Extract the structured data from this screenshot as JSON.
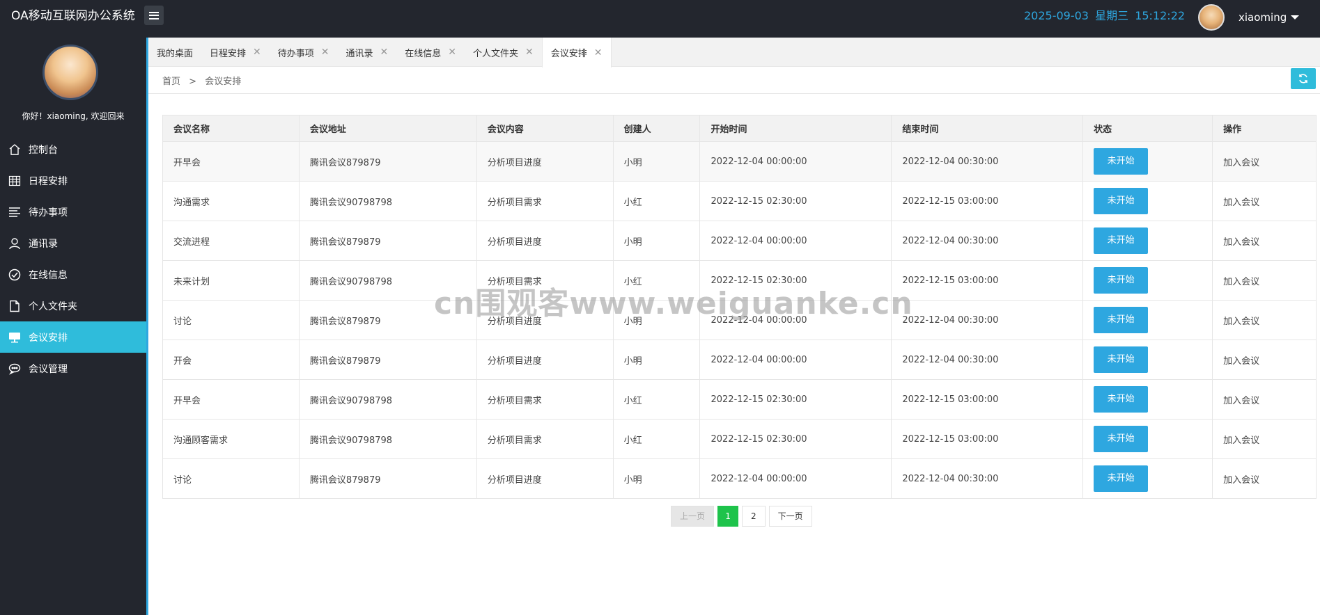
{
  "header": {
    "app_title": "OA移动互联网办公系统",
    "date": "2025-09-03",
    "weekday": "星期三",
    "time": "15:12:22",
    "username": "xiaoming"
  },
  "sidebar": {
    "welcome": "你好！xiaoming, 欢迎回来",
    "items": [
      {
        "label": "控制台",
        "icon": "home-icon"
      },
      {
        "label": "日程安排",
        "icon": "calendar-grid-icon"
      },
      {
        "label": "待办事项",
        "icon": "list-icon"
      },
      {
        "label": "通讯录",
        "icon": "user-icon"
      },
      {
        "label": "在线信息",
        "icon": "check-circle-icon"
      },
      {
        "label": "个人文件夹",
        "icon": "file-icon"
      },
      {
        "label": "会议安排",
        "icon": "presentation-icon",
        "active": true
      },
      {
        "label": "会议管理",
        "icon": "chat-icon"
      }
    ]
  },
  "tabs": [
    {
      "label": "我的桌面",
      "closable": false
    },
    {
      "label": "日程安排",
      "closable": true
    },
    {
      "label": "待办事项",
      "closable": true
    },
    {
      "label": "通讯录",
      "closable": true
    },
    {
      "label": "在线信息",
      "closable": true
    },
    {
      "label": "个人文件夹",
      "closable": true
    },
    {
      "label": "会议安排",
      "closable": true,
      "active": true
    }
  ],
  "breadcrumb": {
    "home": "首页",
    "separator": ">",
    "current": "会议安排"
  },
  "table": {
    "headers": [
      "会议名称",
      "会议地址",
      "会议内容",
      "创建人",
      "开始时间",
      "结束时间",
      "状态",
      "操作"
    ],
    "rows": [
      [
        "开早会",
        "腾讯会议879879",
        "分析项目进度",
        "小明",
        "2022-12-04 00:00:00",
        "2022-12-04 00:30:00",
        "未开始",
        "加入会议"
      ],
      [
        "沟通需求",
        "腾讯会议90798798",
        "分析项目需求",
        "小红",
        "2022-12-15 02:30:00",
        "2022-12-15 03:00:00",
        "未开始",
        "加入会议"
      ],
      [
        "交流进程",
        "腾讯会议879879",
        "分析项目进度",
        "小明",
        "2022-12-04 00:00:00",
        "2022-12-04 00:30:00",
        "未开始",
        "加入会议"
      ],
      [
        "未来计划",
        "腾讯会议90798798",
        "分析项目需求",
        "小红",
        "2022-12-15 02:30:00",
        "2022-12-15 03:00:00",
        "未开始",
        "加入会议"
      ],
      [
        "讨论",
        "腾讯会议879879",
        "分析项目进度",
        "小明",
        "2022-12-04 00:00:00",
        "2022-12-04 00:30:00",
        "未开始",
        "加入会议"
      ],
      [
        "开会",
        "腾讯会议879879",
        "分析项目进度",
        "小明",
        "2022-12-04 00:00:00",
        "2022-12-04 00:30:00",
        "未开始",
        "加入会议"
      ],
      [
        "开早会",
        "腾讯会议90798798",
        "分析项目需求",
        "小红",
        "2022-12-15 02:30:00",
        "2022-12-15 03:00:00",
        "未开始",
        "加入会议"
      ],
      [
        "沟通顾客需求",
        "腾讯会议90798798",
        "分析项目需求",
        "小红",
        "2022-12-15 02:30:00",
        "2022-12-15 03:00:00",
        "未开始",
        "加入会议"
      ],
      [
        "讨论",
        "腾讯会议879879",
        "分析项目进度",
        "小明",
        "2022-12-04 00:00:00",
        "2022-12-04 00:30:00",
        "未开始",
        "加入会议"
      ]
    ]
  },
  "pagination": {
    "prev": "上一页",
    "pages": [
      "1",
      "2"
    ],
    "current": "1",
    "next": "下一页"
  },
  "watermark": "cn围观客www.weiguanke.cn",
  "colors": {
    "header_bg": "#23262e",
    "sidebar_active": "#2fbcdb",
    "accent_blue": "#2ea7e0",
    "page_current": "#1ec34b"
  }
}
